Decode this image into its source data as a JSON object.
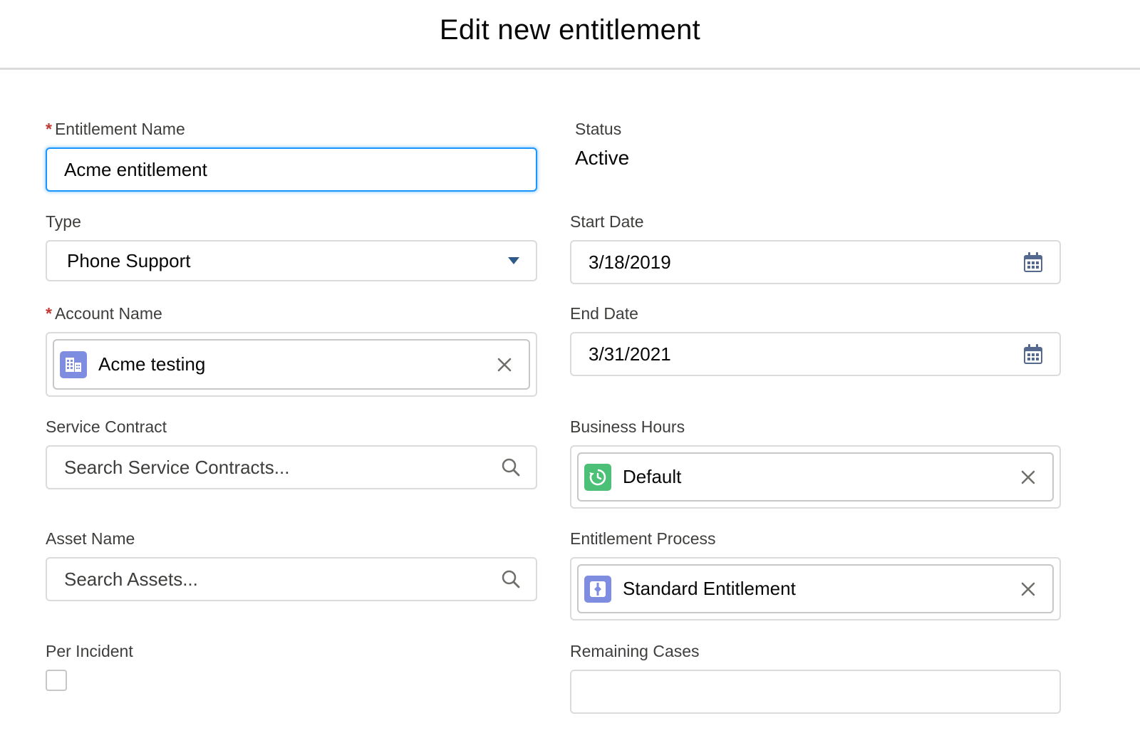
{
  "modal": {
    "title": "Edit new entitlement"
  },
  "form": {
    "entitlement_name": {
      "label": "Entitlement Name",
      "required_mark": "*",
      "value": "Acme entitlement"
    },
    "status": {
      "label": "Status",
      "value": "Active"
    },
    "type": {
      "label": "Type",
      "value": "Phone Support"
    },
    "start_date": {
      "label": "Start Date",
      "value": "3/18/2019"
    },
    "account_name": {
      "label": "Account Name",
      "required_mark": "*",
      "value": "Acme testing",
      "icon": "account-icon",
      "icon_color": "#7f8de1"
    },
    "end_date": {
      "label": "End Date",
      "value": "3/31/2021"
    },
    "service_contract": {
      "label": "Service Contract",
      "placeholder": "Search Service Contracts..."
    },
    "business_hours": {
      "label": "Business Hours",
      "value": "Default",
      "icon": "business-hours-icon",
      "icon_color": "#4bc076"
    },
    "asset_name": {
      "label": "Asset Name",
      "placeholder": "Search Assets..."
    },
    "entitlement_process": {
      "label": "Entitlement Process",
      "value": "Standard Entitlement",
      "icon": "entitlement-process-icon",
      "icon_color": "#7f8de1"
    },
    "per_incident": {
      "label": "Per Incident",
      "checked": false
    },
    "remaining_cases": {
      "label": "Remaining Cases",
      "value": ""
    }
  },
  "colors": {
    "focus_border": "#1b96ff",
    "required": "#c23934",
    "icon_gray": "#706e6b",
    "calendar_icon": "#54698d",
    "dropdown_arrow": "#2e5a8a"
  }
}
